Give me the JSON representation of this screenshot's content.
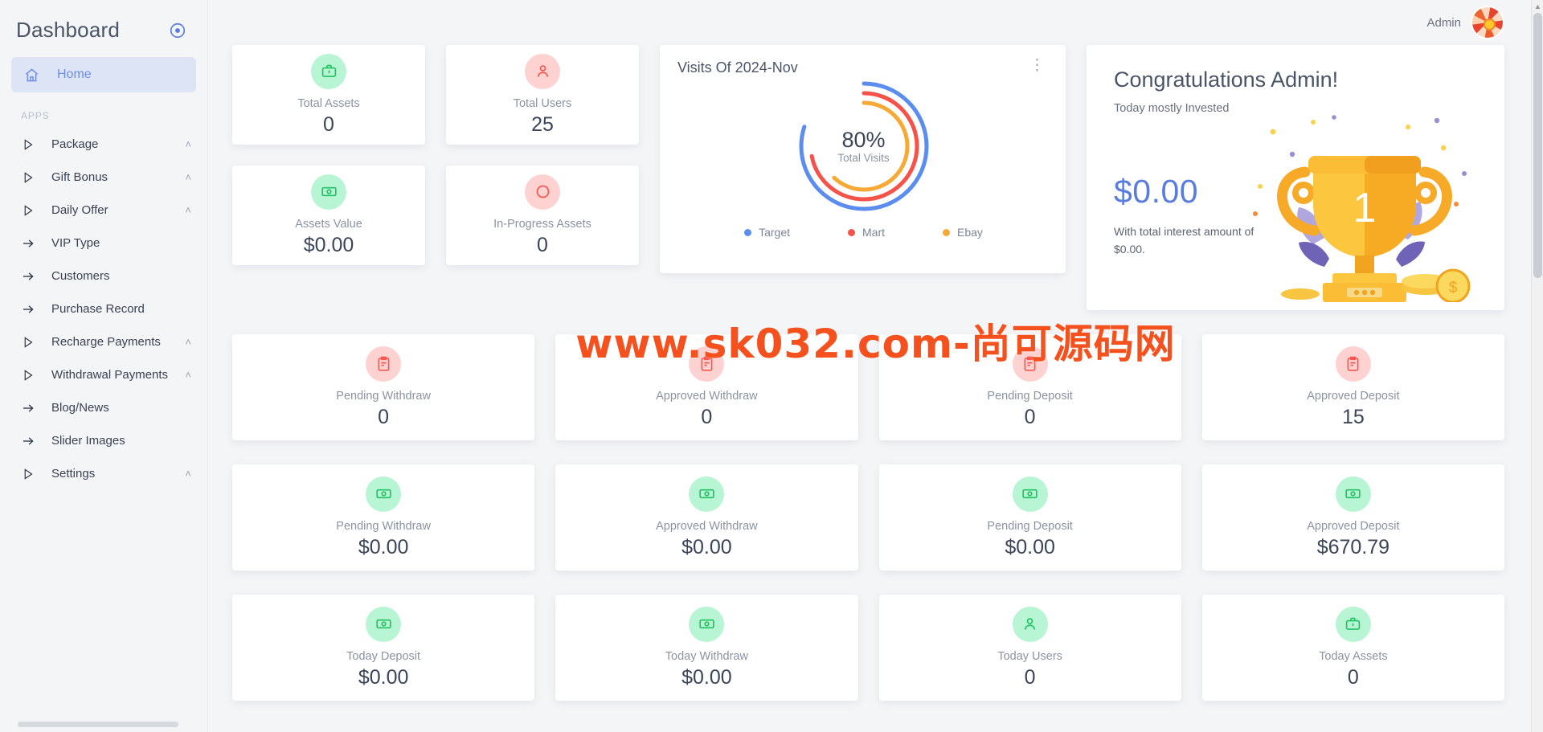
{
  "sidebar": {
    "brand_title": "Dashboard",
    "brand_icon": "target-icon",
    "home_label": "Home",
    "section_label": "APPS",
    "items": [
      {
        "label": "Package",
        "glyph": "triangle",
        "caret": "˄"
      },
      {
        "label": "Gift Bonus",
        "glyph": "triangle",
        "caret": "˄"
      },
      {
        "label": "Daily Offer",
        "glyph": "triangle",
        "caret": "˄"
      },
      {
        "label": "VIP Type",
        "glyph": "arrow",
        "caret": ""
      },
      {
        "label": "Customers",
        "glyph": "arrow",
        "caret": ""
      },
      {
        "label": "Purchase Record",
        "glyph": "arrow",
        "caret": ""
      },
      {
        "label": "Recharge Payments",
        "glyph": "triangle",
        "caret": "˄"
      },
      {
        "label": "Withdrawal Payments",
        "glyph": "triangle",
        "caret": "˄"
      },
      {
        "label": "Blog/News",
        "glyph": "arrow",
        "caret": ""
      },
      {
        "label": "Slider Images",
        "glyph": "arrow",
        "caret": ""
      },
      {
        "label": "Settings",
        "glyph": "triangle",
        "caret": "˄"
      }
    ]
  },
  "topbar": {
    "admin_label": "Admin"
  },
  "watermark": "www.sk032.com-尚可源码网",
  "stats_small": [
    {
      "title": "Total Assets",
      "value": "0",
      "icon": "briefcase-icon",
      "tone": "green"
    },
    {
      "title": "Assets Value",
      "value": "$0.00",
      "icon": "money-icon",
      "tone": "green"
    },
    {
      "title": "Total Users",
      "value": "25",
      "icon": "user-icon",
      "tone": "red"
    },
    {
      "title": "In-Progress Assets",
      "value": "0",
      "icon": "circle-icon",
      "tone": "red"
    }
  ],
  "chart_data": {
    "type": "pie",
    "title": "Visits Of 2024-Nov",
    "center_value": "80%",
    "center_label": "Total Visits",
    "legend_position": "bottom",
    "categories": [
      "Target",
      "Mart",
      "Ebay"
    ],
    "series": [
      {
        "name": "Target",
        "value": 80,
        "color": "#5a8dee"
      },
      {
        "name": "Mart",
        "value": 72,
        "color": "#f5524a"
      },
      {
        "name": "Ebay",
        "value": 62,
        "color": "#f6a934"
      }
    ],
    "menu_icon": "kebab-menu-icon"
  },
  "congrats": {
    "heading": "Congratulations Admin!",
    "subheading": "Today mostly Invested",
    "amount": "$0.00",
    "note": "With total interest amount of $0.00.",
    "illustration": "trophy-illustration"
  },
  "rows": [
    [
      {
        "title": "Pending Withdraw",
        "value": "0",
        "icon": "clipboard-icon",
        "tone": "red"
      },
      {
        "title": "Approved Withdraw",
        "value": "0",
        "icon": "clipboard-icon",
        "tone": "red"
      },
      {
        "title": "Pending Deposit",
        "value": "0",
        "icon": "clipboard-icon",
        "tone": "red"
      },
      {
        "title": "Approved Deposit",
        "value": "15",
        "icon": "clipboard-icon",
        "tone": "red"
      }
    ],
    [
      {
        "title": "Pending Withdraw",
        "value": "$0.00",
        "icon": "money-icon",
        "tone": "green"
      },
      {
        "title": "Approved Withdraw",
        "value": "$0.00",
        "icon": "money-icon",
        "tone": "green"
      },
      {
        "title": "Pending Deposit",
        "value": "$0.00",
        "icon": "money-icon",
        "tone": "green"
      },
      {
        "title": "Approved Deposit",
        "value": "$670.79",
        "icon": "money-icon",
        "tone": "green"
      }
    ],
    [
      {
        "title": "Today Deposit",
        "value": "$0.00",
        "icon": "money-icon",
        "tone": "green"
      },
      {
        "title": "Today Withdraw",
        "value": "$0.00",
        "icon": "money-icon",
        "tone": "green"
      },
      {
        "title": "Today Users",
        "value": "0",
        "icon": "user-icon",
        "tone": "green"
      },
      {
        "title": "Today Assets",
        "value": "0",
        "icon": "briefcase-icon",
        "tone": "green"
      }
    ]
  ],
  "colors": {
    "accent": "#5a7ce0",
    "green": "#22c462",
    "red": "#f8574f",
    "orange": "#f6a934",
    "text_dark": "#3b4558",
    "text_muted": "#8b93a1"
  }
}
